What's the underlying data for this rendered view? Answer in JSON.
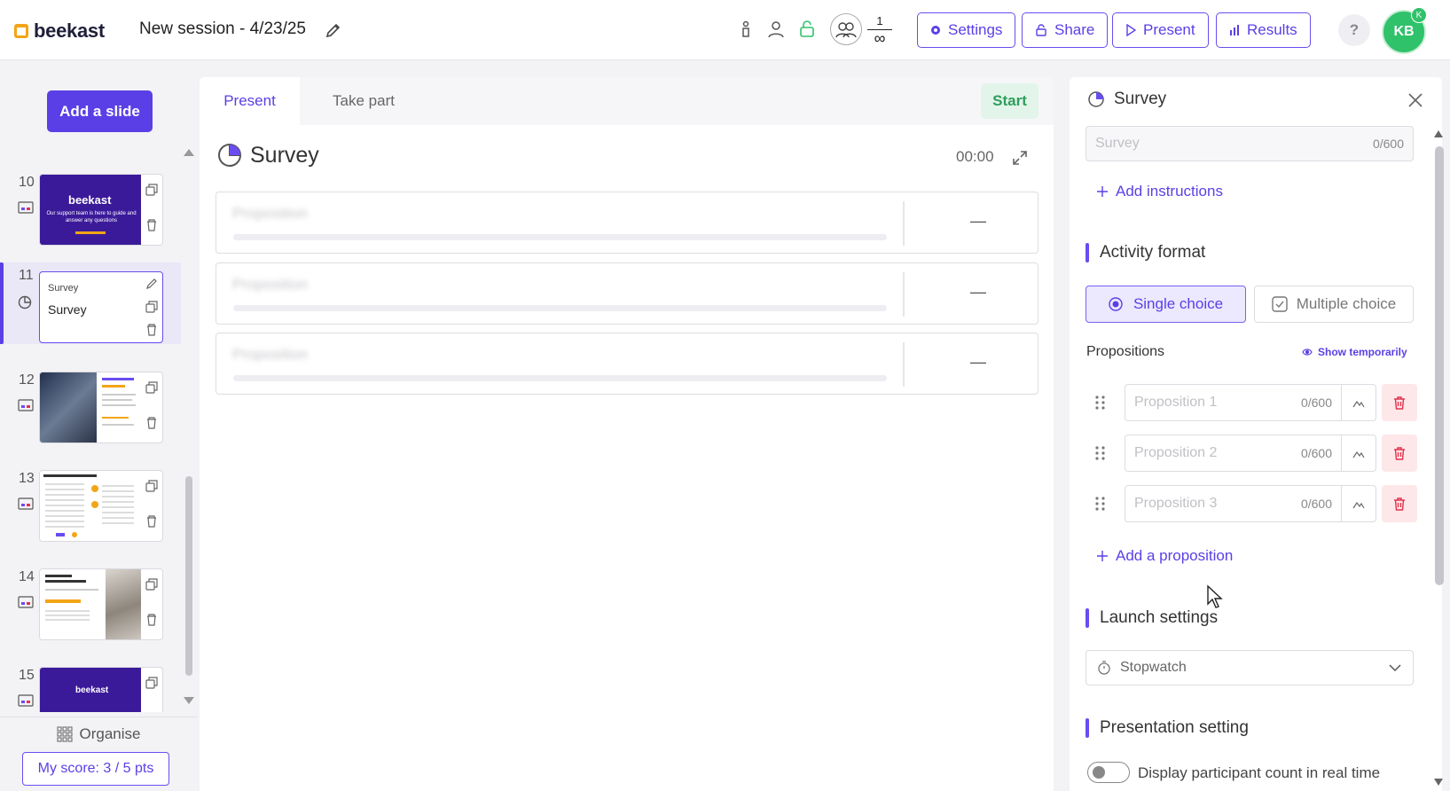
{
  "app": {
    "logo_text": "beekast",
    "session_title": "New session - 4/23/25"
  },
  "header": {
    "participants": {
      "current": "1",
      "max": "∞"
    },
    "buttons": {
      "settings": "Settings",
      "share": "Share",
      "present": "Present",
      "results": "Results"
    },
    "help": "?",
    "avatar_initials": "KB",
    "avatar_badge": "K"
  },
  "sidebar": {
    "add_slide": "Add a slide",
    "slides": [
      {
        "number": "10",
        "type": "content",
        "thumb_title": "beekast",
        "thumb_sub": "Our support team is here to guide and answer any questions"
      },
      {
        "number": "11",
        "type": "survey",
        "thumb_label": "Survey",
        "thumb_title": "Survey"
      },
      {
        "number": "12",
        "type": "content"
      },
      {
        "number": "13",
        "type": "content"
      },
      {
        "number": "14",
        "type": "content"
      },
      {
        "number": "15",
        "type": "content",
        "thumb_title": "beekast"
      }
    ],
    "organise": "Organise",
    "score": "My score: 3 / 5 pts"
  },
  "center": {
    "tabs": {
      "present": "Present",
      "take_part": "Take part"
    },
    "start": "Start",
    "title": "Survey",
    "timer": "00:00",
    "propositions": [
      {
        "label": "Proposition",
        "value": "—"
      },
      {
        "label": "Proposition",
        "value": "—"
      },
      {
        "label": "Proposition",
        "value": "—"
      }
    ]
  },
  "panel": {
    "title": "Survey",
    "survey_input": {
      "placeholder": "Survey",
      "count": "0/600"
    },
    "add_instructions": "Add instructions",
    "activity_format": {
      "heading": "Activity format",
      "single": "Single choice",
      "multiple": "Multiple choice",
      "selected": "single"
    },
    "propositions": {
      "heading": "Propositions",
      "show_temporarily": "Show temporarily",
      "items": [
        {
          "placeholder": "Proposition 1",
          "count": "0/600"
        },
        {
          "placeholder": "Proposition 2",
          "count": "0/600"
        },
        {
          "placeholder": "Proposition 3",
          "count": "0/600"
        }
      ],
      "add": "Add a proposition"
    },
    "launch_settings": {
      "heading": "Launch settings",
      "timer_mode": "Stopwatch"
    },
    "presentation_setting": {
      "heading": "Presentation setting",
      "participant_count_label": "Display participant count in real time",
      "participant_count_enabled": false
    }
  },
  "colors": {
    "accent": "#5b3fe6",
    "start_green": "#2f9d5c",
    "danger": "#e0334c",
    "avatar": "#2fc26a",
    "logo": "#f2a516"
  }
}
